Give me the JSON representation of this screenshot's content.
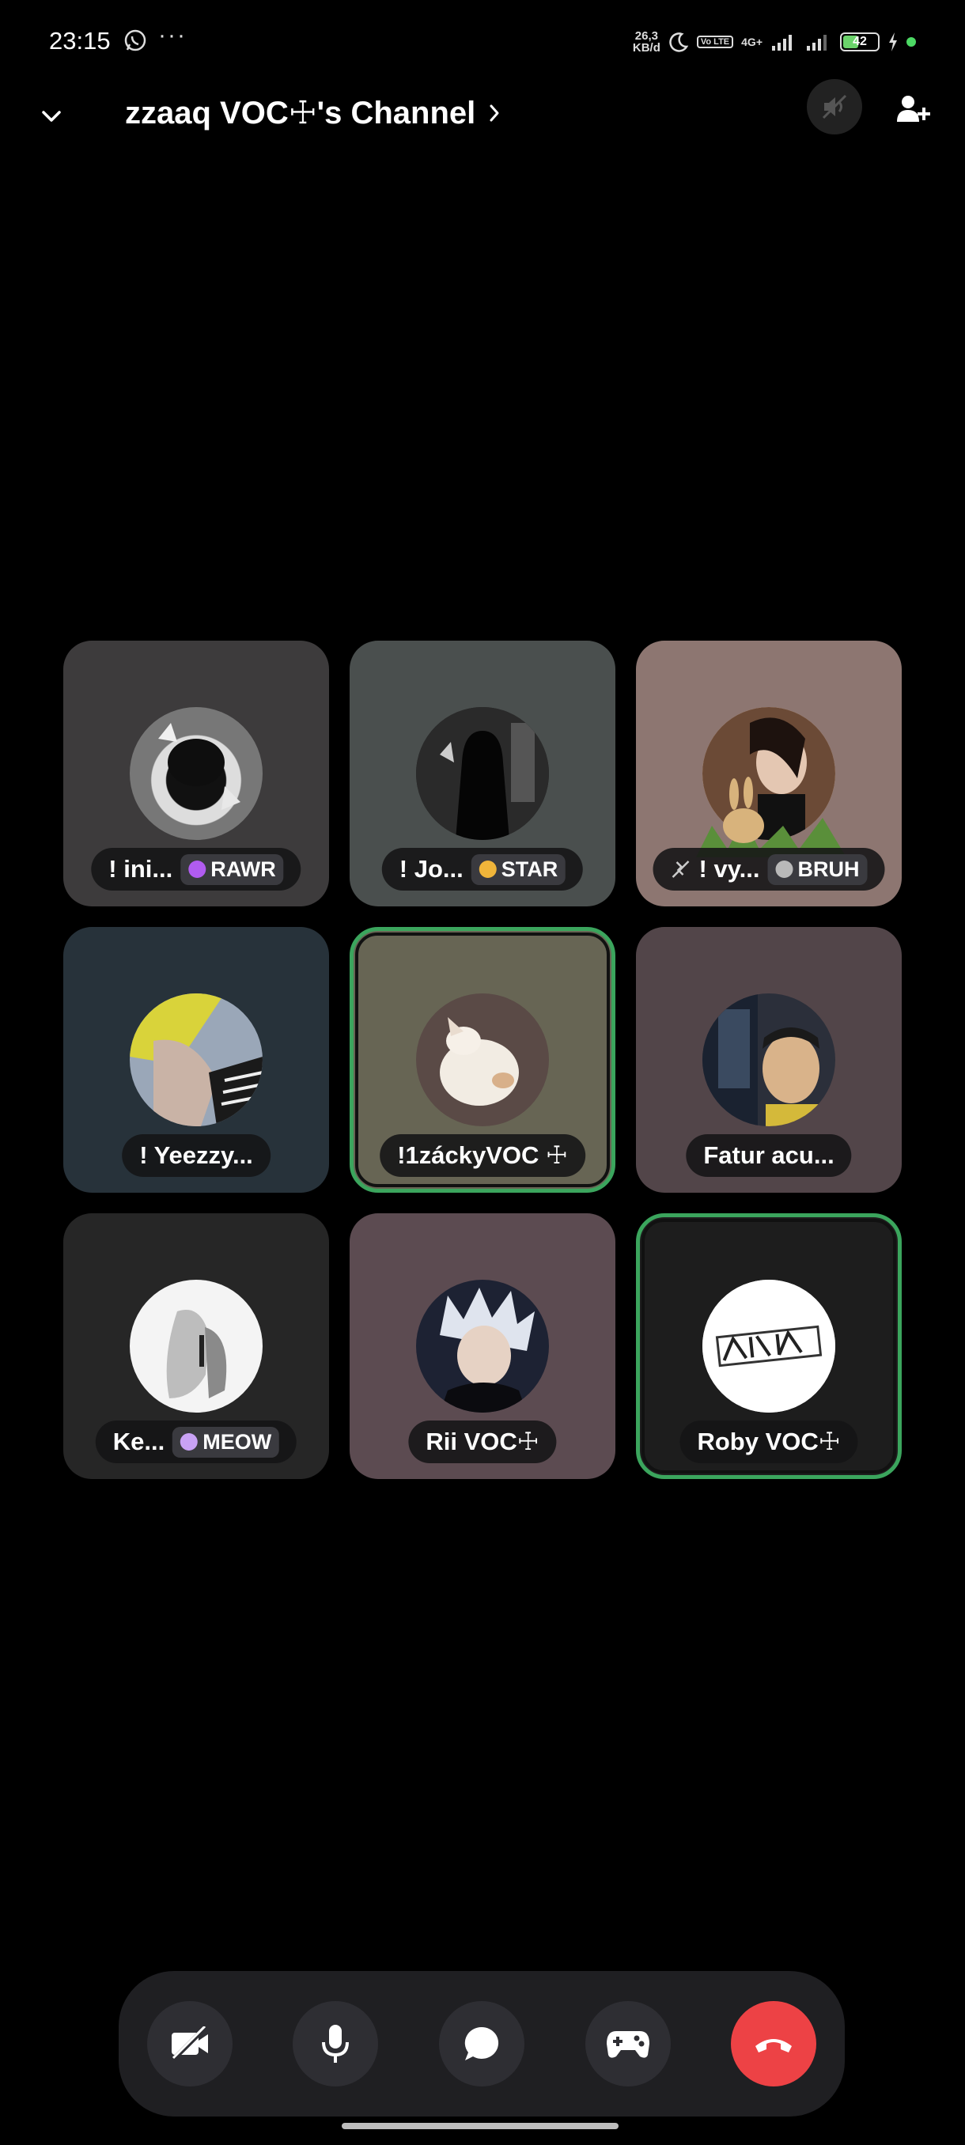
{
  "status_bar": {
    "time": "23:15",
    "notification_icons": [
      "whatsapp-icon",
      "more-dots-icon"
    ],
    "more": "···",
    "speed_value": "26,3",
    "speed_unit": "KB/d",
    "network": "4G+",
    "volte": "Vo LTE",
    "battery": "42",
    "battery_color": "#6bd36b"
  },
  "header": {
    "channel_name": "zzaaq VOC☩'s Channel",
    "collapse_icon": "chevron-down-icon",
    "speaker_icon": "speaker-muted-icon",
    "invite_icon": "add-person-icon"
  },
  "participants": [
    {
      "name": "! ini...",
      "tag": "RAWR",
      "tag_color": "#b15cf0",
      "bg": "#3d3b3c",
      "speaking": false,
      "muted": false
    },
    {
      "name": "! Jo...",
      "tag": "STAR",
      "tag_color": "#f0b53a",
      "bg": "#4a4f4e",
      "speaking": false,
      "muted": false
    },
    {
      "name": "! vy...",
      "tag": "BRUH",
      "tag_color": "#b9b9b9",
      "bg": "#8d7671",
      "speaking": false,
      "muted": true
    },
    {
      "name": "! Yeezzy...",
      "tag": "",
      "tag_color": "",
      "bg": "#27323a",
      "speaking": false,
      "muted": false
    },
    {
      "name": "!1záckyVOC ☩",
      "tag": "",
      "tag_color": "",
      "bg": "#676554",
      "speaking": true,
      "muted": false
    },
    {
      "name": "Fatur acu...",
      "tag": "",
      "tag_color": "",
      "bg": "#524549",
      "speaking": false,
      "muted": false
    },
    {
      "name": "Ke...",
      "tag": "MEOW",
      "tag_color": "#c9a2f5",
      "bg": "#262626",
      "speaking": false,
      "muted": false
    },
    {
      "name": "Rii VOC☩",
      "tag": "",
      "tag_color": "",
      "bg": "#5c4b51",
      "speaking": false,
      "muted": false
    },
    {
      "name": "Roby VOC☩",
      "tag": "",
      "tag_color": "",
      "bg": "#1d1d1d",
      "speaking": true,
      "muted": false
    }
  ],
  "controls": {
    "video": "camera-off-icon",
    "mic": "microphone-icon",
    "chat": "chat-bubble-icon",
    "activities": "gamepad-icon",
    "hangup": "hang-up-icon",
    "hangup_color": "#ed4245",
    "speaking_color": "#3ba55d"
  }
}
